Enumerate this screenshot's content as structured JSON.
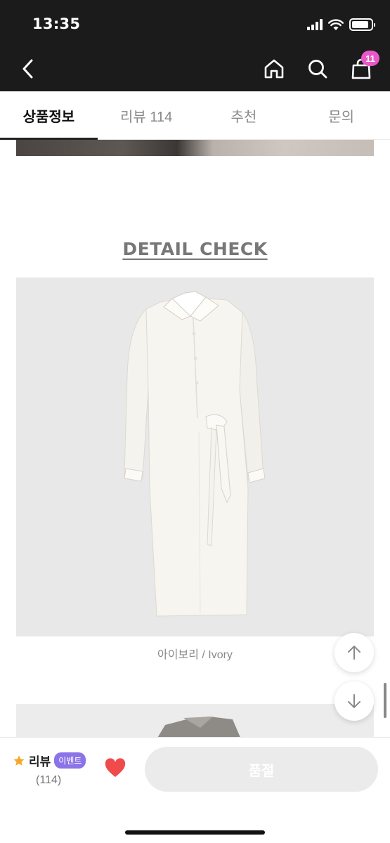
{
  "status_bar": {
    "time": "13:35",
    "battery_level": 0.9
  },
  "nav": {
    "cart_count": "11",
    "icons": [
      "back-icon",
      "home-icon",
      "search-icon",
      "shopping-bag-icon"
    ]
  },
  "tabs": [
    {
      "label": "상품정보",
      "active": true
    },
    {
      "label": "리뷰 114",
      "active": false
    },
    {
      "label": "추천",
      "active": false
    },
    {
      "label": "문의",
      "active": false
    }
  ],
  "content": {
    "detail_heading": "DETAIL CHECK",
    "photo_caption": "아이보리 / Ivory"
  },
  "bottom_bar": {
    "review_label": "리뷰",
    "event_badge": "이벤트",
    "review_count": "(114)",
    "soldout_label": "품절"
  },
  "colors": {
    "header_bg": "#1b1b1b",
    "cart_badge": "#e957c8",
    "event_badge": "#8b74e8",
    "heart": "#f04a4a",
    "star": "#f5a623"
  }
}
